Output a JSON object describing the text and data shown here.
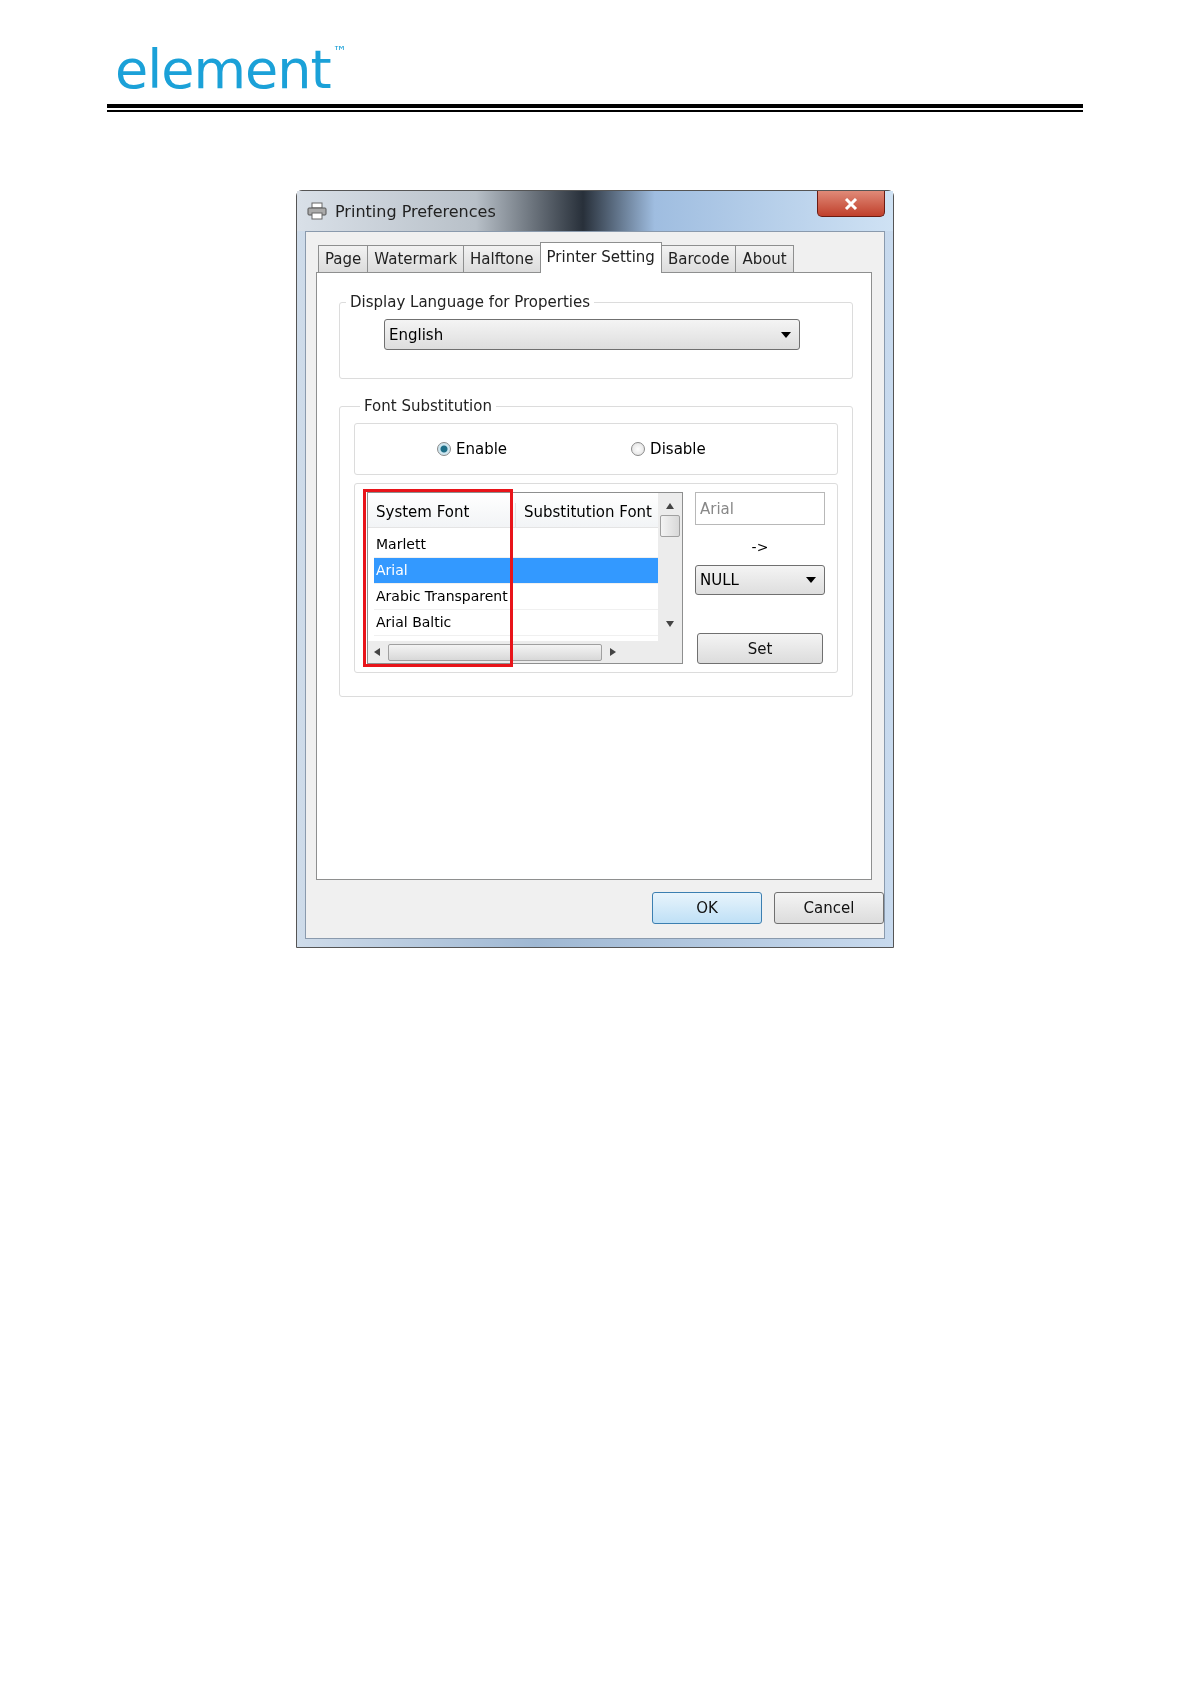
{
  "header": {
    "logo": "element",
    "trademark": "™"
  },
  "window": {
    "title": "Printing Preferences"
  },
  "tabs": [
    {
      "label": "Page",
      "selected": false
    },
    {
      "label": "Watermark",
      "selected": false
    },
    {
      "label": "Halftone",
      "selected": false
    },
    {
      "label": "Printer Setting",
      "selected": true
    },
    {
      "label": "Barcode",
      "selected": false
    },
    {
      "label": "About",
      "selected": false
    }
  ],
  "display_language": {
    "legend": "Display Language for Properties",
    "value": "English"
  },
  "font_substitution": {
    "legend": "Font Substitution",
    "options": [
      {
        "label": "Enable",
        "selected": true
      },
      {
        "label": "Disable",
        "selected": false
      }
    ],
    "table": {
      "columns": [
        "System Font",
        "Substitution Font"
      ],
      "rows": [
        {
          "system_font": "Marlett",
          "selected": false
        },
        {
          "system_font": "Arial",
          "selected": true
        },
        {
          "system_font": "Arabic Transparent",
          "selected": false
        },
        {
          "system_font": "Arial Baltic",
          "selected": false
        }
      ],
      "highlighted": true
    },
    "source_font": {
      "value": "Arial"
    },
    "arrow": "->",
    "target_font": {
      "value": "NULL"
    },
    "set_button": "Set"
  },
  "buttons": [
    {
      "label": "OK",
      "default": true
    },
    {
      "label": "Cancel",
      "default": false
    }
  ]
}
